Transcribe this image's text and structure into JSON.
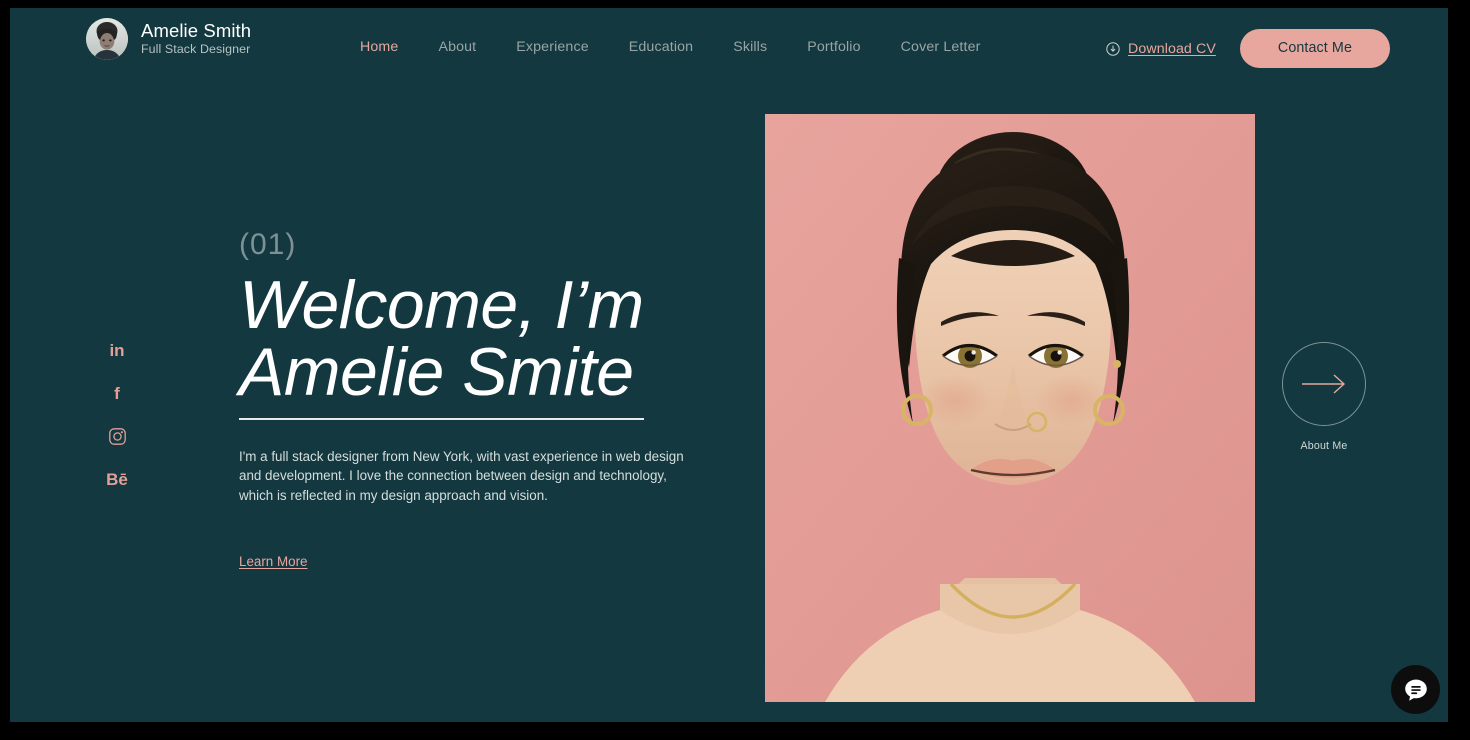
{
  "theme": {
    "background": "#13383f",
    "accent_pink": "#e8a79e",
    "muted_text": "#97a5a6",
    "white": "#ffffff",
    "frame": "#000000"
  },
  "header": {
    "brand": {
      "avatar_icon": "avatar-photo",
      "name": "Amelie Smith",
      "role": "Full Stack Designer"
    },
    "nav": [
      {
        "label": "Home",
        "active": true
      },
      {
        "label": "About",
        "active": false
      },
      {
        "label": "Experience",
        "active": false
      },
      {
        "label": "Education",
        "active": false
      },
      {
        "label": "Skills",
        "active": false
      },
      {
        "label": "Portfolio",
        "active": false
      },
      {
        "label": "Cover Letter",
        "active": false
      }
    ],
    "download_cv": {
      "icon": "download-circle-icon",
      "label": "Download CV"
    },
    "contact_button": {
      "label": "Contact Me"
    }
  },
  "socials": [
    {
      "name": "linkedin",
      "glyph": "in"
    },
    {
      "name": "facebook",
      "glyph": "f"
    },
    {
      "name": "instagram",
      "glyph": ""
    },
    {
      "name": "behance",
      "glyph": "Bē"
    }
  ],
  "hero": {
    "eyebrow": "(01)",
    "title_line1": "Welcome, I’m",
    "title_line2": "Amelie Smite",
    "description": "I'm a full stack designer from New York, with vast experience in web design and development. I love the connection between design and technology, which is reflected in my design approach and vision.",
    "learn_more_label": "Learn More",
    "portrait_alt": "portrait-photo"
  },
  "about_me": {
    "arrow_icon": "arrow-right-icon",
    "label": "About Me"
  },
  "chat": {
    "icon": "chat-bubble-icon"
  }
}
